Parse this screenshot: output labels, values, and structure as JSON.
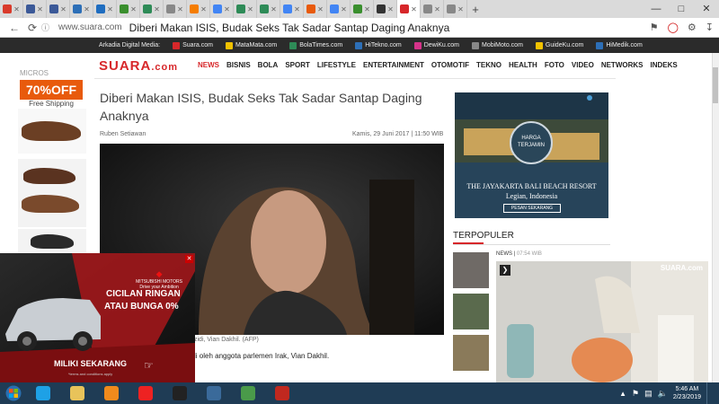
{
  "browser": {
    "tabs": [
      {
        "icon": "red-square-icon",
        "color": "#d93a2b"
      },
      {
        "icon": "facebook-icon",
        "color": "#3b5998"
      },
      {
        "icon": "facebook-icon",
        "color": "#3b5998"
      },
      {
        "icon": "cloud-icon",
        "color": "#2d6fb7"
      },
      {
        "icon": "outlook-icon",
        "color": "#1f6dc0"
      },
      {
        "icon": "puzzle-icon",
        "color": "#3a8f2e"
      },
      {
        "icon": "home-icon",
        "color": "#2e8b57"
      },
      {
        "icon": "document-icon",
        "color": "#888888"
      },
      {
        "icon": "blogger-icon",
        "color": "#f57d00"
      },
      {
        "icon": "google-icon",
        "color": "#4285f4"
      },
      {
        "icon": "home-icon",
        "color": "#2e8b57"
      },
      {
        "icon": "home-icon",
        "color": "#2e8b57"
      },
      {
        "icon": "google-icon",
        "color": "#4285f4"
      },
      {
        "icon": "link-icon",
        "color": "#e85a0c"
      },
      {
        "icon": "google-icon",
        "color": "#4285f4"
      },
      {
        "icon": "puzzle-icon",
        "color": "#3a8f2e"
      },
      {
        "icon": "spider-icon",
        "color": "#333333"
      },
      {
        "icon": "suara-icon",
        "color": "#d7272a"
      },
      {
        "icon": "globe-icon",
        "color": "#888888"
      },
      {
        "icon": "globe-icon",
        "color": "#888888"
      }
    ],
    "new_tab": "+",
    "url_domain": "www.suara.com",
    "url_title": "Diberi Makan ISIS, Budak Seks Tak Sadar Santap Daging Anaknya"
  },
  "network_bar": [
    {
      "label": "Arkadia Digital Media:",
      "color": ""
    },
    {
      "label": "Suara.com",
      "color": "#d7272a"
    },
    {
      "label": "MataMata.com",
      "color": "#f2c200"
    },
    {
      "label": "BolaTimes.com",
      "color": "#2e8b57"
    },
    {
      "label": "HiTekno.com",
      "color": "#2d6fb7"
    },
    {
      "label": "DewiKu.com",
      "color": "#d6338a"
    },
    {
      "label": "MobiMoto.com",
      "color": "#888888"
    },
    {
      "label": "GuideKu.com",
      "color": "#f2c200"
    },
    {
      "label": "HiMedik.com",
      "color": "#2d6fb7"
    }
  ],
  "site": {
    "logo_main": "SUARA",
    "logo_suffix": ".com",
    "nav": [
      "NEWS",
      "BISNIS",
      "BOLA",
      "SPORT",
      "LIFESTYLE",
      "ENTERTAINMENT",
      "OTOMOTIF",
      "TEKNO",
      "HEALTH",
      "FOTO",
      "VIDEO",
      "NETWORKS",
      "INDEKS"
    ]
  },
  "left_ad": {
    "top": "MICROS",
    "discount": "70%OFF",
    "sub": "Free Shipping"
  },
  "article": {
    "title": "Diberi Makan ISIS, Budak Seks Tak Sadar Santap Daging Anaknya",
    "author": "Ruben Setiawan",
    "date": "Kamis, 29 Juni 2017 | 11:50 WIB",
    "caption": "zidi, Vian Dakhil. (AFP)",
    "body": "li oleh anggota parlemen Irak, Vian Dakhil."
  },
  "right_ad": {
    "seal": "HARGA TERJAMIN",
    "line1": "THE JAYAKARTA BALI BEACH RESORT",
    "line2": "Legian, Indonesia",
    "button": "PESAN SEKARANG"
  },
  "sidebar": {
    "heading": "TERPOPULER",
    "news_label": "NEWS",
    "news_time": "07:54 WIB",
    "video_logo": "SUARA.com"
  },
  "car_ad": {
    "brand": "MITSUBISHI MOTORS",
    "brand_tag": "Drive your Ambition",
    "line1": "CICILAN RINGAN",
    "line2": "ATAU BUNGA 0%",
    "cta": "MILIKI SEKARANG",
    "terms": "*terms and conditions apply"
  },
  "taskbar": {
    "apps": [
      "ie-icon",
      "explorer-icon",
      "media-player-icon",
      "yandex-icon",
      "blackberry-icon",
      "earth-icon",
      "monitor-icon",
      "filezilla-icon"
    ],
    "time": "5:46 AM",
    "date": "2/23/2019"
  }
}
